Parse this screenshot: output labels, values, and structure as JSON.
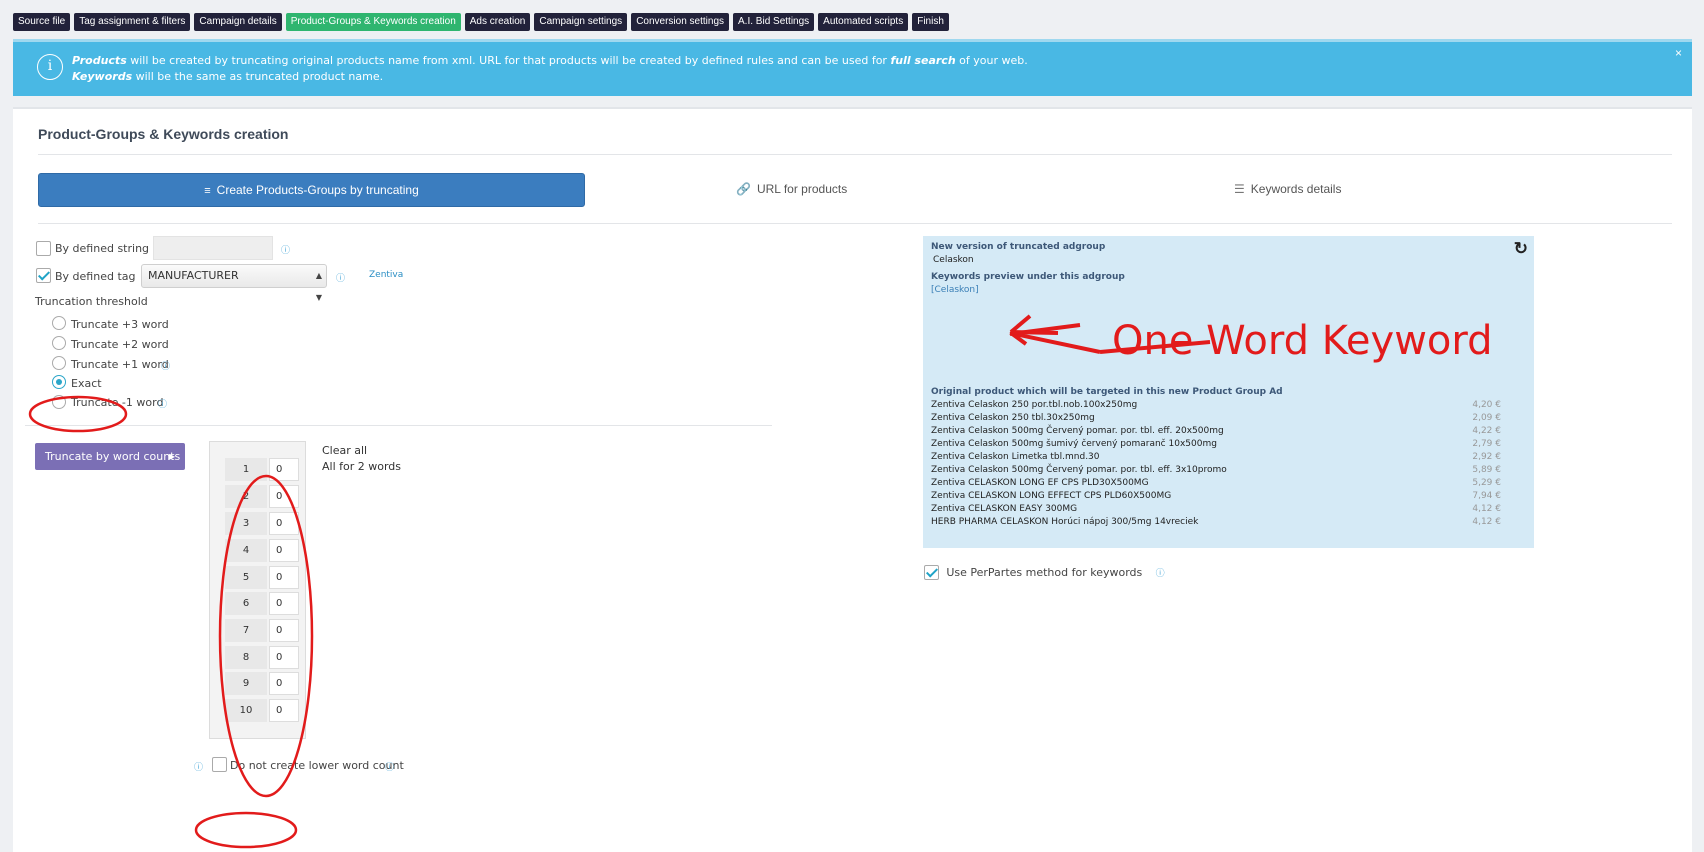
{
  "steps": [
    {
      "label": "Source file"
    },
    {
      "label": "Tag assignment & filters"
    },
    {
      "label": "Campaign details"
    },
    {
      "label": "Product-Groups & Keywords creation",
      "active": true
    },
    {
      "label": "Ads creation"
    },
    {
      "label": "Campaign settings"
    },
    {
      "label": "Conversion settings"
    },
    {
      "label": "A.I. Bid Settings"
    },
    {
      "label": "Automated scripts"
    },
    {
      "label": "Finish"
    }
  ],
  "banner": {
    "line1_b1": "Products",
    "line1_t1": " will be created by truncating original products name from xml. URL for that products will be created by defined rules and can be used for ",
    "line1_b2": "full search",
    "line1_t2": " of your web.",
    "line2_b1": "Keywords",
    "line2_t1": " will be the same as truncated product name.",
    "close": "×"
  },
  "panel": {
    "title": "Product-Groups & Keywords creation",
    "tabs": {
      "primary": "Create Products-Groups by truncating",
      "url": "URL for products",
      "keywords": "Keywords details"
    }
  },
  "form": {
    "by_string": "By defined string",
    "by_tag": "By defined tag",
    "tag_value": "MANUFACTURER",
    "tag_example": "Zentiva",
    "threshold_label": "Truncation threshold",
    "radios": [
      "Truncate +3 word",
      "Truncate +2 word",
      "Truncate +1 word",
      "Exact",
      "Truncate -1 word"
    ],
    "truncate_button": "Truncate by word counts",
    "clear_all": "Clear all",
    "all_for_2": "All for 2 words",
    "word_counts": [
      {
        "n": "1",
        "v": "0"
      },
      {
        "n": "2",
        "v": "0"
      },
      {
        "n": "3",
        "v": "0"
      },
      {
        "n": "4",
        "v": "0"
      },
      {
        "n": "5",
        "v": "0"
      },
      {
        "n": "6",
        "v": "0"
      },
      {
        "n": "7",
        "v": "0"
      },
      {
        "n": "8",
        "v": "0"
      },
      {
        "n": "9",
        "v": "0"
      },
      {
        "n": "10",
        "v": "0"
      }
    ],
    "no_lower": "Do not create lower word count"
  },
  "preview": {
    "new_version_label": "New version of truncated adgroup",
    "adgroup": "Celaskon",
    "keywords_label": "Keywords preview under this adgroup",
    "keyword": "[Celaskon]",
    "original_label": "Original product which will be targeted in this new Product Group Ad",
    "products": [
      {
        "name": "Zentiva Celaskon 250 por.tbl.nob.100x250mg",
        "price": "4,20 €"
      },
      {
        "name": "Zentiva Celaskon 250 tbl.30x250mg",
        "price": "2,09 €"
      },
      {
        "name": "Zentiva Celaskon 500mg Červený pomar. por. tbl. eff. 20x500mg",
        "price": "4,22 €"
      },
      {
        "name": "Zentiva Celaskon 500mg šumivý červený pomaranč 10x500mg",
        "price": "2,79 €"
      },
      {
        "name": "Zentiva Celaskon Limetka tbl.mnd.30",
        "price": "2,92 €"
      },
      {
        "name": "Zentiva Celaskon 500mg Červený pomar. por. tbl. eff. 3x10promo",
        "price": "5,89 €"
      },
      {
        "name": "Zentiva CELASKON LONG EF CPS PLD30X500MG",
        "price": "5,29 €"
      },
      {
        "name": "Zentiva CELASKON LONG EFFECT CPS PLD60X500MG",
        "price": "7,94 €"
      },
      {
        "name": "Zentiva CELASKON EASY 300MG",
        "price": "4,12 €"
      },
      {
        "name": "HERB PHARMA CELASKON Horúci nápoj 300/5mg 14vreciek",
        "price": "4,12 €"
      }
    ],
    "perpartes": "Use PerPartes method for keywords"
  },
  "annotation": {
    "text": "One Word Keyword",
    "color": "#e21b1b"
  }
}
